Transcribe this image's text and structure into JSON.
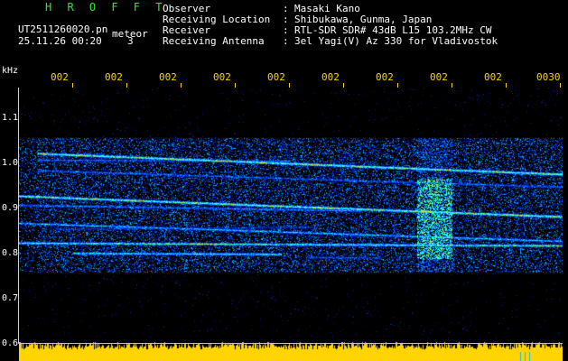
{
  "header": {
    "brand": "H R O F F T",
    "file_name": "UT2511260020.pn",
    "meteor_label": "meteor",
    "datetime": "25.11.26 00:20",
    "count": "3",
    "info": [
      {
        "label": "Observer",
        "value": "Masaki Kano"
      },
      {
        "label": "Receiving Location",
        "value": "Shibukawa, Gunma, Japan"
      },
      {
        "label": "Receiver",
        "value": "RTL-SDR SDR# 43dB L15 103.2MHz CW"
      },
      {
        "label": "Receiving Antenna",
        "value": "3el Yagi(V) Az 330 for Vladivostok"
      }
    ]
  },
  "axis": {
    "unit": "kHz",
    "y_ticks": [
      "1.1",
      "1.0",
      "0.9",
      "0.8",
      "0.7",
      "0.6"
    ],
    "x_ticks": [
      "002",
      "002",
      "002",
      "002",
      "002",
      "002",
      "002",
      "002",
      "002",
      "0030"
    ]
  },
  "colors": {
    "brand": "#2eea2e",
    "text": "#ffffff",
    "ticks": "#ffd400",
    "background": "#000000",
    "meter": "#ffd400",
    "meter_marker": "#00c8ff"
  }
}
